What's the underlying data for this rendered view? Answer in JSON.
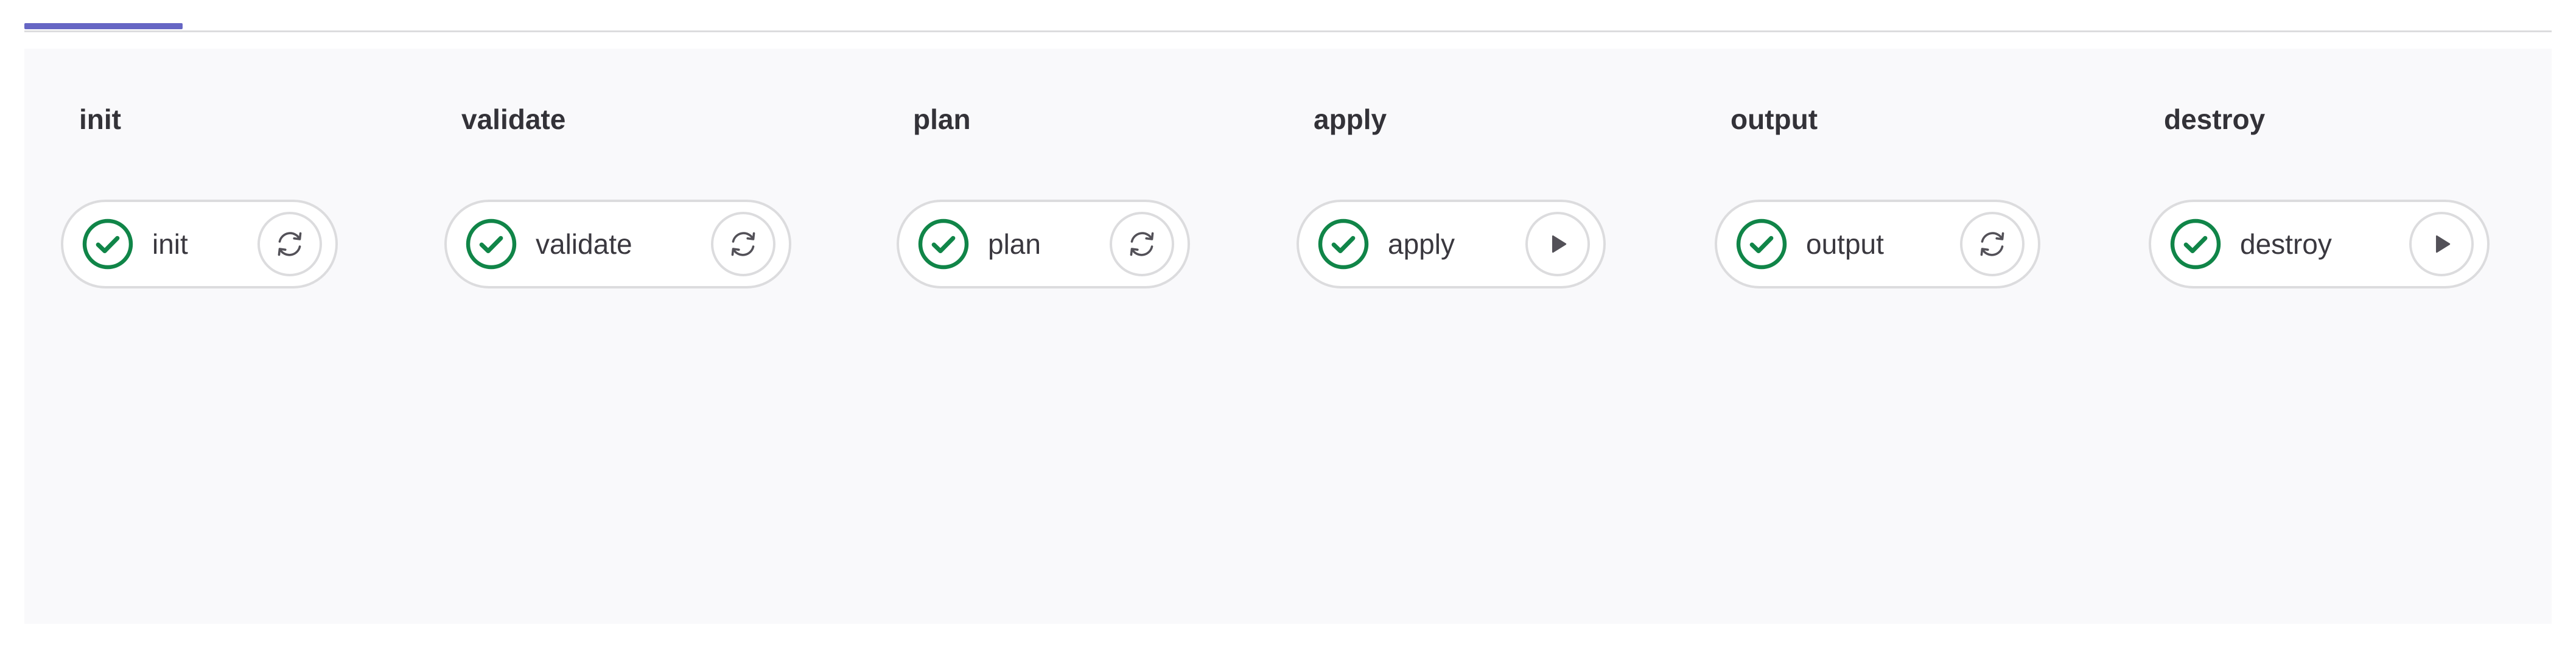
{
  "pipeline": {
    "stages": [
      {
        "title": "init",
        "job": {
          "name": "init",
          "status": "passed",
          "action": "retry"
        }
      },
      {
        "title": "validate",
        "job": {
          "name": "validate",
          "status": "passed",
          "action": "retry"
        }
      },
      {
        "title": "plan",
        "job": {
          "name": "plan",
          "status": "passed",
          "action": "retry"
        }
      },
      {
        "title": "apply",
        "job": {
          "name": "apply",
          "status": "passed",
          "action": "play"
        }
      },
      {
        "title": "output",
        "job": {
          "name": "output",
          "status": "passed",
          "action": "retry"
        }
      },
      {
        "title": "destroy",
        "job": {
          "name": "destroy",
          "status": "passed",
          "action": "play"
        }
      }
    ]
  },
  "icons": {
    "status": "check-circle-icon",
    "retry": "retry-icon",
    "play": "play-icon"
  },
  "colors": {
    "success": "#108548",
    "accent": "#6666c4",
    "border": "#dcdcde",
    "background": "#f9f9fb",
    "icon": "#535158"
  }
}
